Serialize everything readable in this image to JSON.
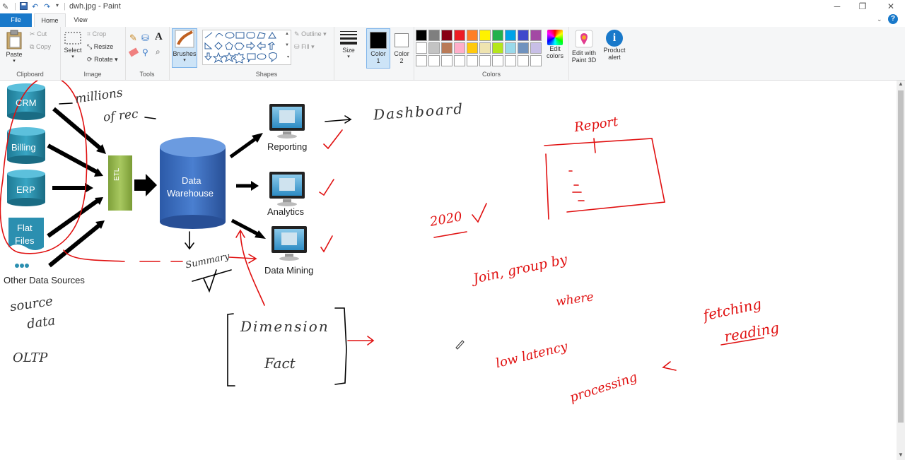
{
  "titlebar": {
    "title": "dwh.jpg - Paint"
  },
  "tabs": {
    "file": "File",
    "home": "Home",
    "view": "View"
  },
  "ribbon": {
    "clipboard": {
      "label": "Clipboard",
      "paste": "Paste",
      "cut": "Cut",
      "copy": "Copy"
    },
    "image": {
      "label": "Image",
      "select": "Select",
      "crop": "Crop",
      "resize": "Resize",
      "rotate": "Rotate"
    },
    "tools": {
      "label": "Tools"
    },
    "brushes": {
      "label": "Brushes"
    },
    "shapes": {
      "label": "Shapes",
      "outline": "Outline",
      "fill": "Fill"
    },
    "size": {
      "label": "Size"
    },
    "color1": {
      "label": "Color",
      "num": "1"
    },
    "color2": {
      "label": "Color",
      "num": "2"
    },
    "colors": {
      "label": "Colors",
      "row1": [
        "#000000",
        "#7f7f7f",
        "#880015",
        "#ed1c24",
        "#ff7f27",
        "#fff200",
        "#22b14c",
        "#00a2e8",
        "#3f48cc",
        "#a349a4"
      ],
      "row2": [
        "#ffffff",
        "#c3c3c3",
        "#b97a57",
        "#ffaec9",
        "#ffc90e",
        "#efe4b0",
        "#b5e61d",
        "#99d9ea",
        "#7092be",
        "#c8bfe7"
      ],
      "edit_colors": [
        "Edit",
        "colors"
      ]
    },
    "paint3d": {
      "line1": "Edit with",
      "line2": "Paint 3D"
    },
    "product_alert": {
      "line1": "Product",
      "line2": "alert"
    }
  },
  "diagram": {
    "sources": [
      "CRM",
      "Billing",
      "ERP"
    ],
    "flat_files": [
      "Flat",
      "Files"
    ],
    "other_sources": "Other Data Sources",
    "etl": "ETL",
    "warehouse": [
      "Data",
      "Warehouse"
    ],
    "outputs": [
      "Reporting",
      "Analytics",
      "Data Mining"
    ]
  },
  "handwriting": {
    "millions": "millions",
    "of_rec": "of rec",
    "dashboard": "Dashboard",
    "report": "Report",
    "year": "2020",
    "summary": "Summary",
    "dimension": "Dimension",
    "fact": "Fact",
    "source": "source",
    "data": "data",
    "oltp": "OLTP",
    "join_group_by": "Join, group by",
    "where": "where",
    "low_latency": "low latency",
    "processing": "processing",
    "fetching": "fetching",
    "reading": "reading"
  }
}
